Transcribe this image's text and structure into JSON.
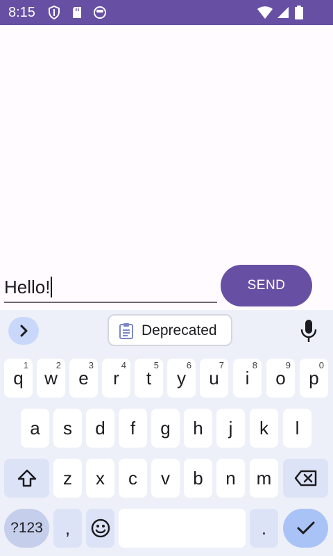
{
  "status_bar": {
    "time": "8:15",
    "icons": [
      "shield-icon",
      "sd-card-icon",
      "circle-app-icon",
      "wifi-icon",
      "signal-icon",
      "battery-icon"
    ]
  },
  "compose": {
    "input_value": "Hello!",
    "send_label": "SEND"
  },
  "keyboard": {
    "clipboard_label": "Deprecated",
    "row1": [
      {
        "label": "q",
        "hint": "1"
      },
      {
        "label": "w",
        "hint": "2"
      },
      {
        "label": "e",
        "hint": "3"
      },
      {
        "label": "r",
        "hint": "4"
      },
      {
        "label": "t",
        "hint": "5"
      },
      {
        "label": "y",
        "hint": "6"
      },
      {
        "label": "u",
        "hint": "7"
      },
      {
        "label": "i",
        "hint": "8"
      },
      {
        "label": "o",
        "hint": "9"
      },
      {
        "label": "p",
        "hint": "0"
      }
    ],
    "row2": [
      "a",
      "s",
      "d",
      "f",
      "g",
      "h",
      "j",
      "k",
      "l"
    ],
    "row3": [
      "z",
      "x",
      "c",
      "v",
      "b",
      "n",
      "m"
    ],
    "symbols_label": "?123",
    "comma_label": ",",
    "period_label": "."
  },
  "colors": {
    "accent": "#6750a4",
    "keyboard_bg": "#eef0f9",
    "special_key": "#dde3f7",
    "enter_key": "#a9c3f7"
  }
}
